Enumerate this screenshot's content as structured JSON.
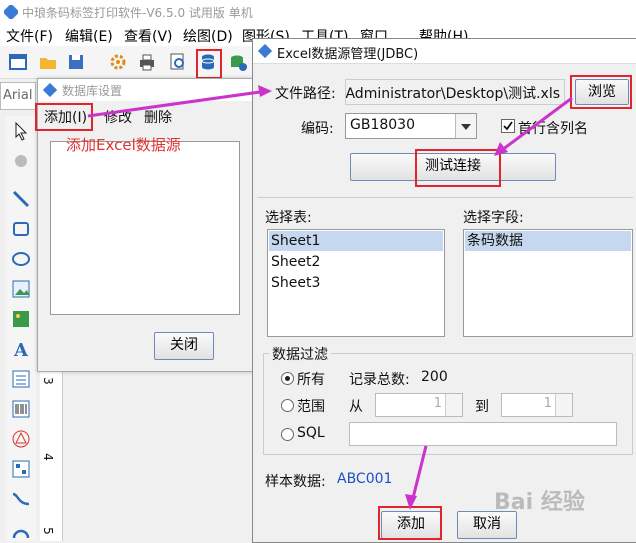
{
  "app": {
    "title": "中琅条码标签打印软件-V6.5.0 试用版 单机",
    "menu": [
      "文件(F)",
      "编辑(E)",
      "查看(V)",
      "绘图(D)",
      "图形(S)",
      "工具(T)",
      "窗口",
      "帮助(H)"
    ],
    "font_name": "Arial",
    "ruler_numbers": [
      "3",
      "4",
      "5"
    ]
  },
  "db_dialog": {
    "title": "数据库设置",
    "add_label": "添加(I)",
    "edit_label": "修改",
    "delete_label": "删除",
    "close_label": "关闭"
  },
  "annotation": {
    "text": "添加Excel数据源"
  },
  "jdbc": {
    "title": "Excel数据源管理(JDBC)",
    "file_path_label": "文件路径:",
    "file_path_value": "ers\\Administrator\\Desktop\\测试.xls",
    "browse_label": "浏览",
    "encoding_label": "编码:",
    "encoding_value": "GB18030",
    "first_row_label": "首行含列名",
    "test_connection_label": "测试连接",
    "select_table_label": "选择表:",
    "tables": [
      "Sheet1",
      "Sheet2",
      "Sheet3"
    ],
    "select_field_label": "选择字段:",
    "fields": [
      "条码数据"
    ],
    "filter_label": "数据过滤",
    "all_label": "所有",
    "record_total_label": "记录总数:",
    "record_total": "200",
    "range_label": "范围",
    "from_label": "从",
    "to_label": "到",
    "range_from": "1",
    "range_to": "1",
    "sql_label": "SQL",
    "sample_label": "样本数据:",
    "sample_value": "ABC001",
    "add_label": "添加",
    "cancel_label": "取消"
  },
  "watermark": "Bai 经验",
  "colors": {
    "accent": "#e0262c",
    "arrow": "#cc33cc",
    "sample": "#1a50c8"
  }
}
